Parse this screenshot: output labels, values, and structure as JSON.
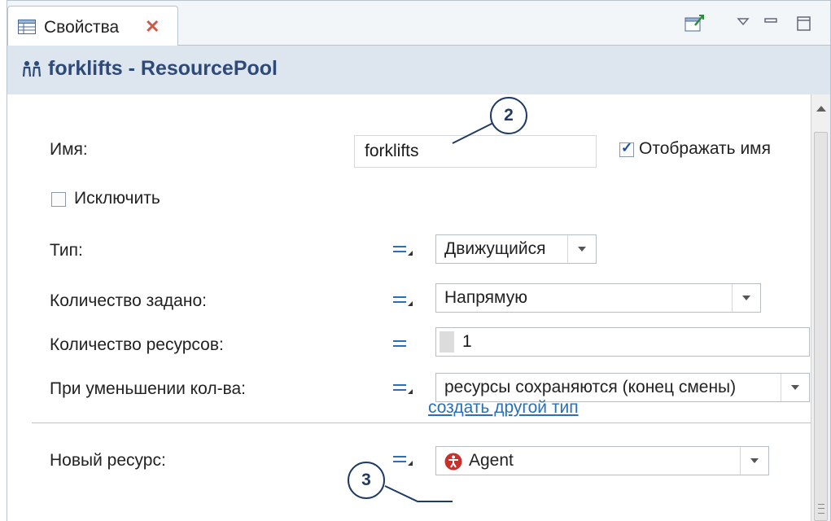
{
  "tab": {
    "label": "Свойства",
    "close": "✕"
  },
  "header": {
    "title": "forklifts - ResourcePool"
  },
  "form": {
    "name": {
      "label": "Имя:",
      "value": "forklifts",
      "show_name_label": "Отображать имя",
      "show_name_checked": true
    },
    "exclude": {
      "label": "Исключить",
      "checked": false
    },
    "type": {
      "label": "Тип:",
      "value": "Движущийся"
    },
    "count_defined": {
      "label": "Количество задано:",
      "value": "Напрямую"
    },
    "resource_count": {
      "label": "Количество ресурсов:",
      "value": "1"
    },
    "on_decrease": {
      "label": "При уменьшении кол-ва:",
      "value": "ресурсы сохраняются (конец смены)"
    },
    "new_resource": {
      "label": "Новый ресурс:",
      "value": "Agent",
      "create_link": "создать другой тип"
    }
  },
  "callouts": [
    "2",
    "3"
  ],
  "colors": {
    "header_bg": "#dde6ef",
    "title": "#2d4a78",
    "link": "#2a6fb8",
    "callout": "#1f3b63"
  }
}
